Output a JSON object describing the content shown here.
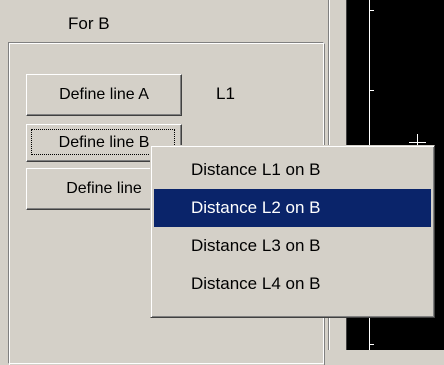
{
  "panel": {
    "title": "For B",
    "buttons": {
      "line_a": "Define line A",
      "line_b": "Define line B",
      "line_c": "Define line"
    },
    "line_a_value": "L1"
  },
  "context_menu": {
    "items": [
      {
        "label": "Distance L1 on B",
        "selected": false
      },
      {
        "label": "Distance L2 on B",
        "selected": true
      },
      {
        "label": "Distance L3 on B",
        "selected": false
      },
      {
        "label": "Distance L4 on B",
        "selected": false
      }
    ]
  },
  "colors": {
    "face": "#d4d0c8",
    "highlight": "#0a246a",
    "view_background": "#000000"
  }
}
